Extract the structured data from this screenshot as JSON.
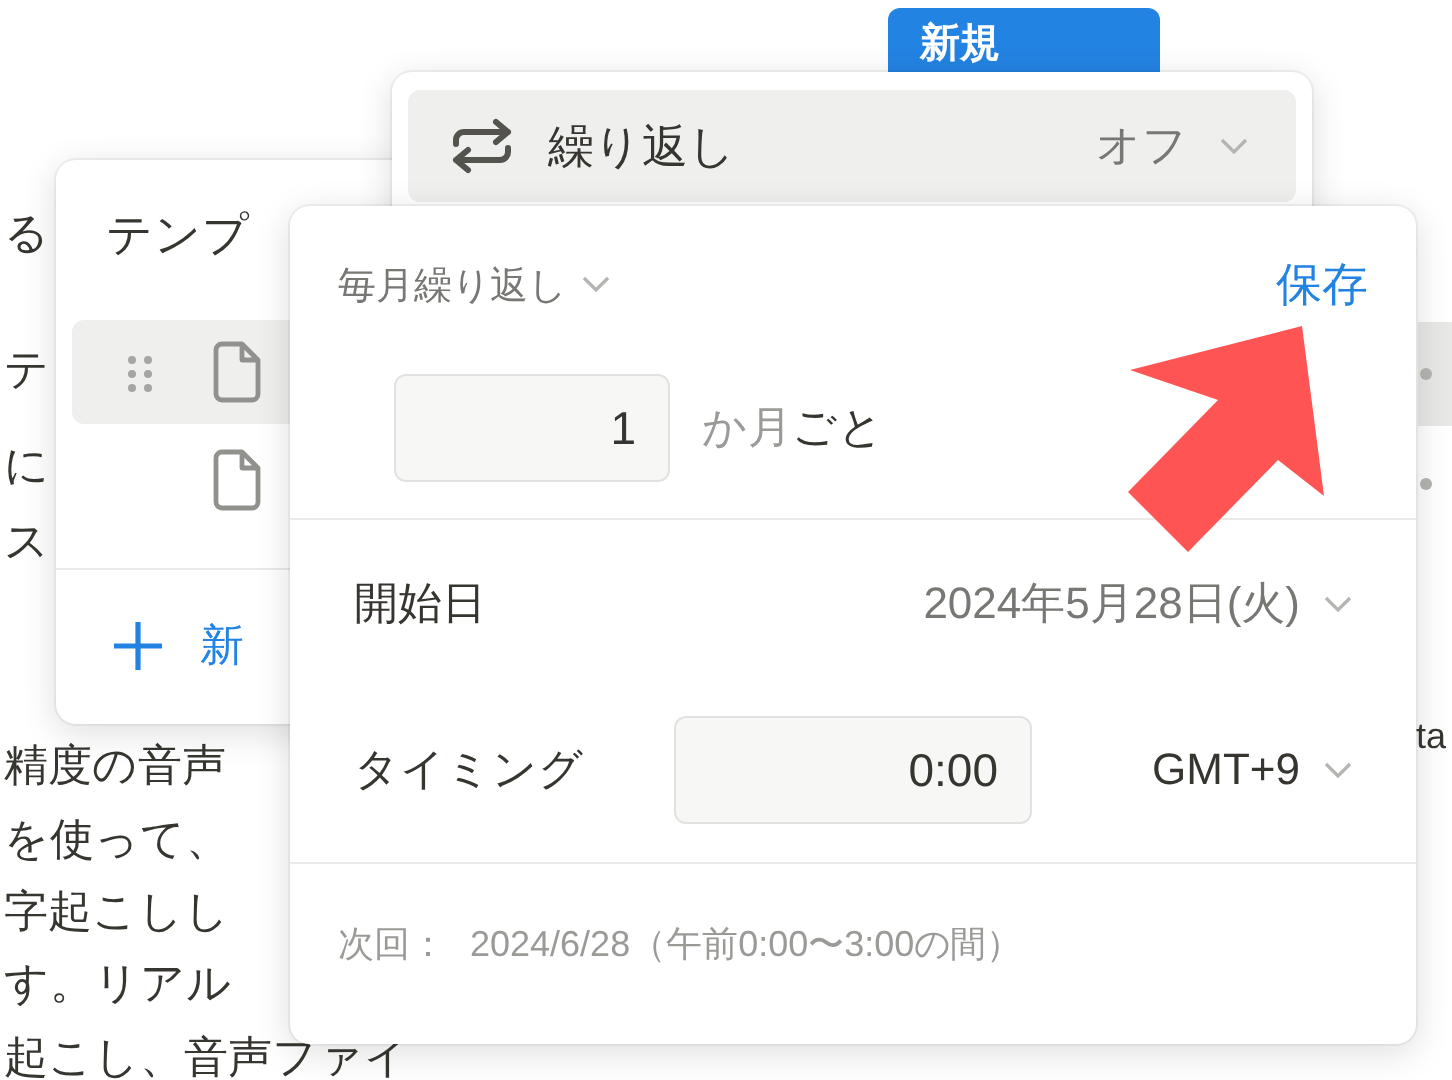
{
  "page": {
    "text_lines": [
      "る",
      "テ",
      "に",
      "ス",
      "精度の音声",
      "を使って、",
      "字起こしし",
      "す。リアル",
      "起こし、音声ファイ"
    ],
    "new_button": "新規",
    "right_text": "ta",
    "right_rows": [
      {
        "selected": true
      },
      {
        "selected": false
      }
    ]
  },
  "template_menu": {
    "title": "テンプ",
    "items": [
      {
        "selected": true
      },
      {
        "selected": false
      }
    ],
    "add_label": "新"
  },
  "repeat_menu": {
    "label": "繰り返し",
    "value": "オフ"
  },
  "repeat_settings": {
    "frequency": "毎月繰り返し",
    "save": "保存",
    "interval": "1",
    "unit": "か月",
    "suffix": "ごと",
    "start_label": "開始日",
    "start_value": "2024年5月28日(火)",
    "timing_label": "タイミング",
    "time": "0:00",
    "timezone": "GMT+9",
    "next_label": "次回：",
    "next_value": "2024/6/28（午前0:00〜3:00の間）"
  }
}
